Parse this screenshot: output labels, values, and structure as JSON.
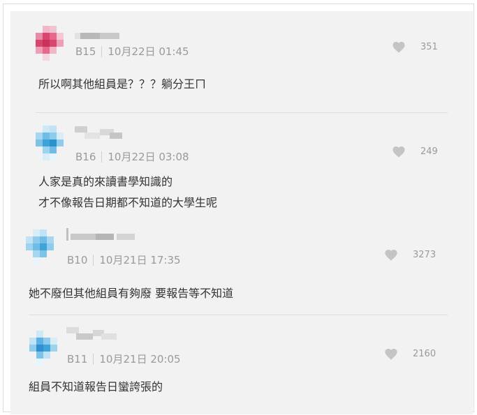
{
  "comments": [
    {
      "floor": "B15",
      "time": "10月22日 01:45",
      "likes": "351",
      "lines": [
        "所以啊其他組員是？？？躺分王ㄇ"
      ],
      "avatar_color": "#d9456d"
    },
    {
      "floor": "B16",
      "time": "10月22日 03:08",
      "likes": "249",
      "lines": [
        "人家是真的來讀書學知識的",
        "才不像報告日期都不知道的大學生呢"
      ],
      "avatar_color": "#3ea3d9"
    },
    {
      "floor": "B10",
      "time": "10月21日 17:35",
      "likes": "3273",
      "lines": [
        "她不廢但其他組員有夠廢 要報告等不知道"
      ],
      "avatar_color": "#3ea3d9"
    },
    {
      "floor": "B11",
      "time": "10月21日 20:05",
      "likes": "2160",
      "lines": [
        "組員不知道報告日蠻誇張的"
      ],
      "avatar_color": "#2f8fd0"
    }
  ],
  "icons": {
    "like": "heart-icon"
  },
  "colors": {
    "meta": "#9a9a9a",
    "text": "#333333",
    "panel": "#f2f2f2"
  }
}
